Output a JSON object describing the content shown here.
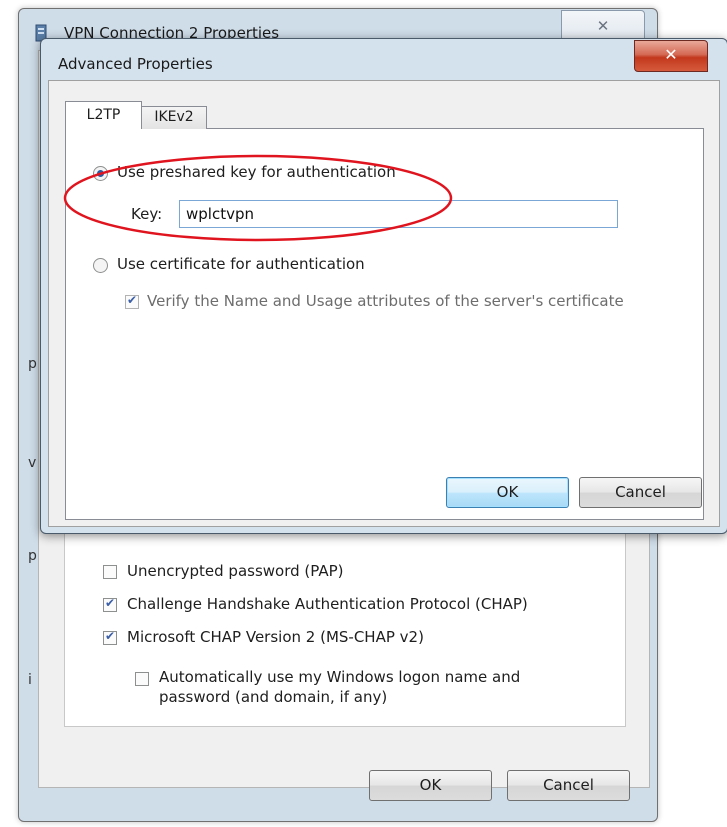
{
  "back_window": {
    "title": "VPN Connection 2 Properties",
    "close_glyph": "✕",
    "left_edge_letters": [
      "p",
      "v",
      "p",
      "i"
    ],
    "auth_options": [
      {
        "label": "Unencrypted password (PAP)",
        "checked": false
      },
      {
        "label": "Challenge Handshake Authentication Protocol (CHAP)",
        "checked": true
      },
      {
        "label": "Microsoft CHAP Version 2 (MS-CHAP v2)",
        "checked": true
      }
    ],
    "auto_logon": {
      "line1": "Automatically use my Windows logon name and",
      "line2": "password (and domain, if any)",
      "checked": false
    },
    "ok_label": "OK",
    "cancel_label": "Cancel"
  },
  "dialog": {
    "title": "Advanced Properties",
    "close_glyph": "✕",
    "tabs": [
      {
        "label": "L2TP",
        "active": true
      },
      {
        "label": "IKEv2",
        "active": false
      }
    ],
    "preshared": {
      "label": "Use preshared key for authentication",
      "selected": true,
      "key_label": "Key:",
      "key_value": "wplctvpn"
    },
    "certificate": {
      "label": "Use certificate for authentication",
      "selected": false,
      "verify_label": "Verify the Name and Usage attributes of the server's certificate",
      "verify_checked": true
    },
    "ok_label": "OK",
    "cancel_label": "Cancel"
  },
  "colors": {
    "annotation_ellipse": "#e0141e",
    "title_close_red": "#c2381d",
    "window_frame": "#d4e2ee"
  }
}
